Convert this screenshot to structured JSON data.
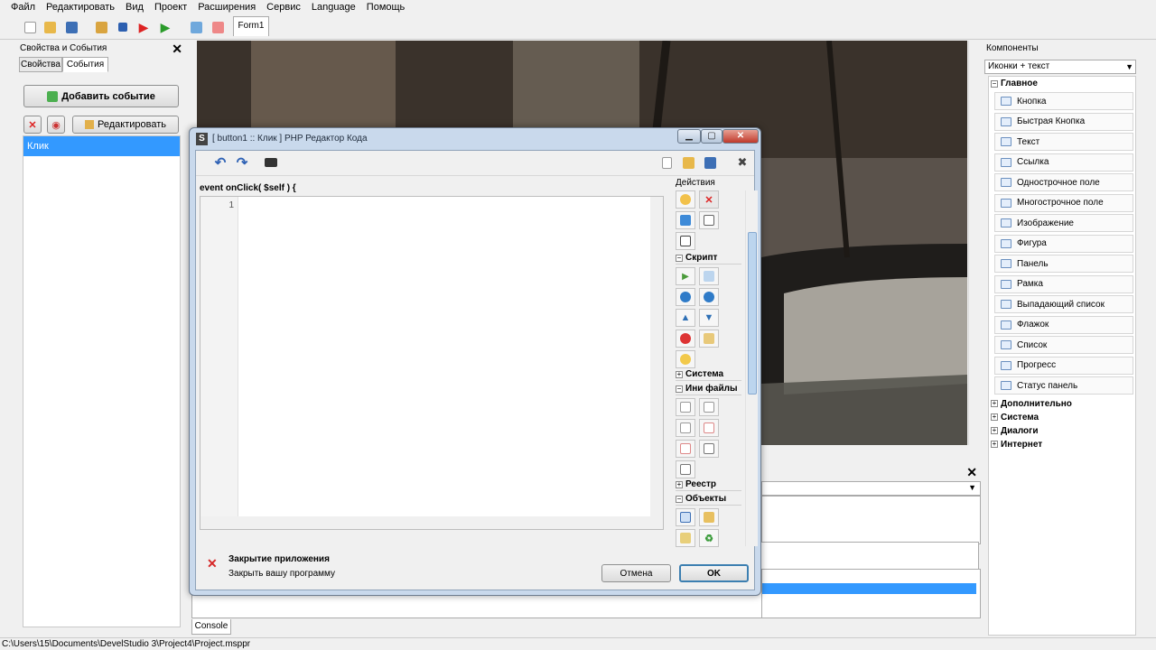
{
  "menu": [
    "Файл",
    "Редактировать",
    "Вид",
    "Проект",
    "Расширения",
    "Сервис",
    "Language",
    "Помощь"
  ],
  "toolbar": {
    "form_tab": "Form1"
  },
  "left_panel": {
    "title": "Свойства и События",
    "tabs": [
      "Свойства",
      "События"
    ],
    "add_event_label": "Добавить событие",
    "edit_label": "Редактировать",
    "events": [
      "Клик"
    ]
  },
  "dialog": {
    "title": "[ button1 :: Клик ] PHP Редактор Кода",
    "event_signature": "event onClick( $self ) {",
    "line_number": "1",
    "actions_label": "Действия",
    "sections": [
      "Скрипт",
      "Система",
      "Ини файлы",
      "Реестр",
      "Объекты"
    ],
    "hint_title": "Закрытие приложения",
    "hint_desc": "Закрыть вашу программу",
    "cancel_label": "Отмена",
    "ok_label": "OK"
  },
  "console_tab": "Console",
  "status_path": "C:\\Users\\15\\Documents\\DevelStudio 3\\Project4\\Project.msppr",
  "right_panel": {
    "title": "Компоненты",
    "view_mode": "Иконки + текст",
    "main_category": "Главное",
    "components": [
      "Кнопка",
      "Быстрая Кнопка",
      "Текст",
      "Ссылка",
      "Однострочное поле",
      "Многострочное поле",
      "Изображение",
      "Фигура",
      "Панель",
      "Рамка",
      "Выпадающий список",
      "Флажок",
      "Список",
      "Прогресс",
      "Статус панель"
    ],
    "other_categories": [
      "Дополнительно",
      "Система",
      "Диалоги",
      "Интернет"
    ]
  },
  "colors": {
    "selection": "#3399ff",
    "dialog_frame": "#c9d9ec"
  }
}
